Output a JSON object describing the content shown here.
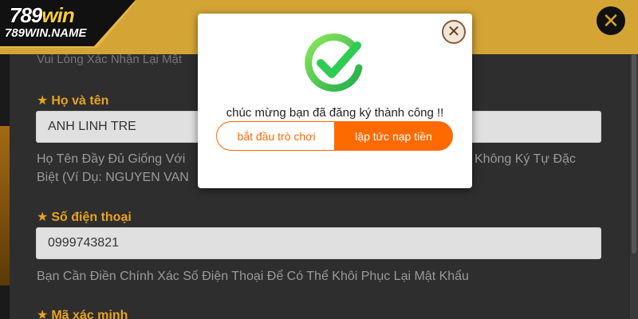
{
  "logo": {
    "main_prefix": "789",
    "main_suffix": "win",
    "sub": "789WIN.NAME"
  },
  "header": {
    "close_glyph": "✕"
  },
  "form": {
    "faded_line": "Vui Lòng Xác Nhận Lại Mật",
    "full_name": {
      "label": "Họ và tên",
      "value": "ANH LINH TRE",
      "hint_line1": "Họ Tên Đầy Đủ Giống Với",
      "hint_line1_right": "Không Ký Tự Đặc",
      "hint_line2": "Biệt (Ví Dụ: NGUYEN VAN"
    },
    "phone": {
      "label": "Số điện thoại",
      "value": "0999743821",
      "hint": "Bạn Cần Điền Chính Xác Số Điện Thoại Để Có Thể Khôi Phục Lại Mật Khẩu"
    },
    "captcha": {
      "label": "Mã xác minh"
    }
  },
  "modal": {
    "close_glyph": "✕",
    "message": "chúc mừng bạn đã đăng ký thành công !!",
    "start_button": "bắt đầu trò chơi",
    "deposit_button": "lập tức nạp tiền"
  },
  "icons": {
    "star": "star-icon",
    "success": "check-circle-icon",
    "close": "close-icon"
  },
  "colors": {
    "header": "#d4a535",
    "accent": "#ff6a00",
    "label": "#e8a320",
    "success": "#2ecc52"
  }
}
